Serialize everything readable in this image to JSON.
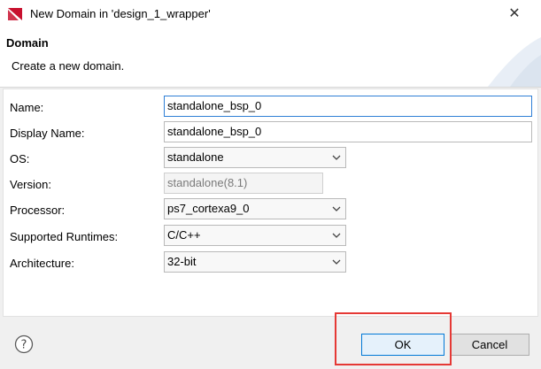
{
  "window": {
    "title": "New Domain in 'design_1_wrapper'",
    "close_glyph": "✕"
  },
  "banner": {
    "title": "Domain",
    "description": "Create a new domain."
  },
  "form": {
    "name": {
      "label": "Name:",
      "value": "standalone_bsp_0"
    },
    "display_name": {
      "label": "Display Name:",
      "value": "standalone_bsp_0"
    },
    "os": {
      "label": "OS:",
      "value": "standalone"
    },
    "version": {
      "label": "Version:",
      "value": "standalone(8.1)"
    },
    "processor": {
      "label": "Processor:",
      "value": "ps7_cortexa9_0"
    },
    "supported_runtimes": {
      "label": "Supported Runtimes:",
      "value": "C/C++"
    },
    "architecture": {
      "label": "Architecture:",
      "value": "32-bit"
    }
  },
  "footer": {
    "help_glyph": "?",
    "ok_label": "OK",
    "cancel_label": "Cancel"
  },
  "colors": {
    "highlight": "#e53935",
    "focus_border": "#2f7fd6",
    "ok_border": "#0078d7"
  }
}
